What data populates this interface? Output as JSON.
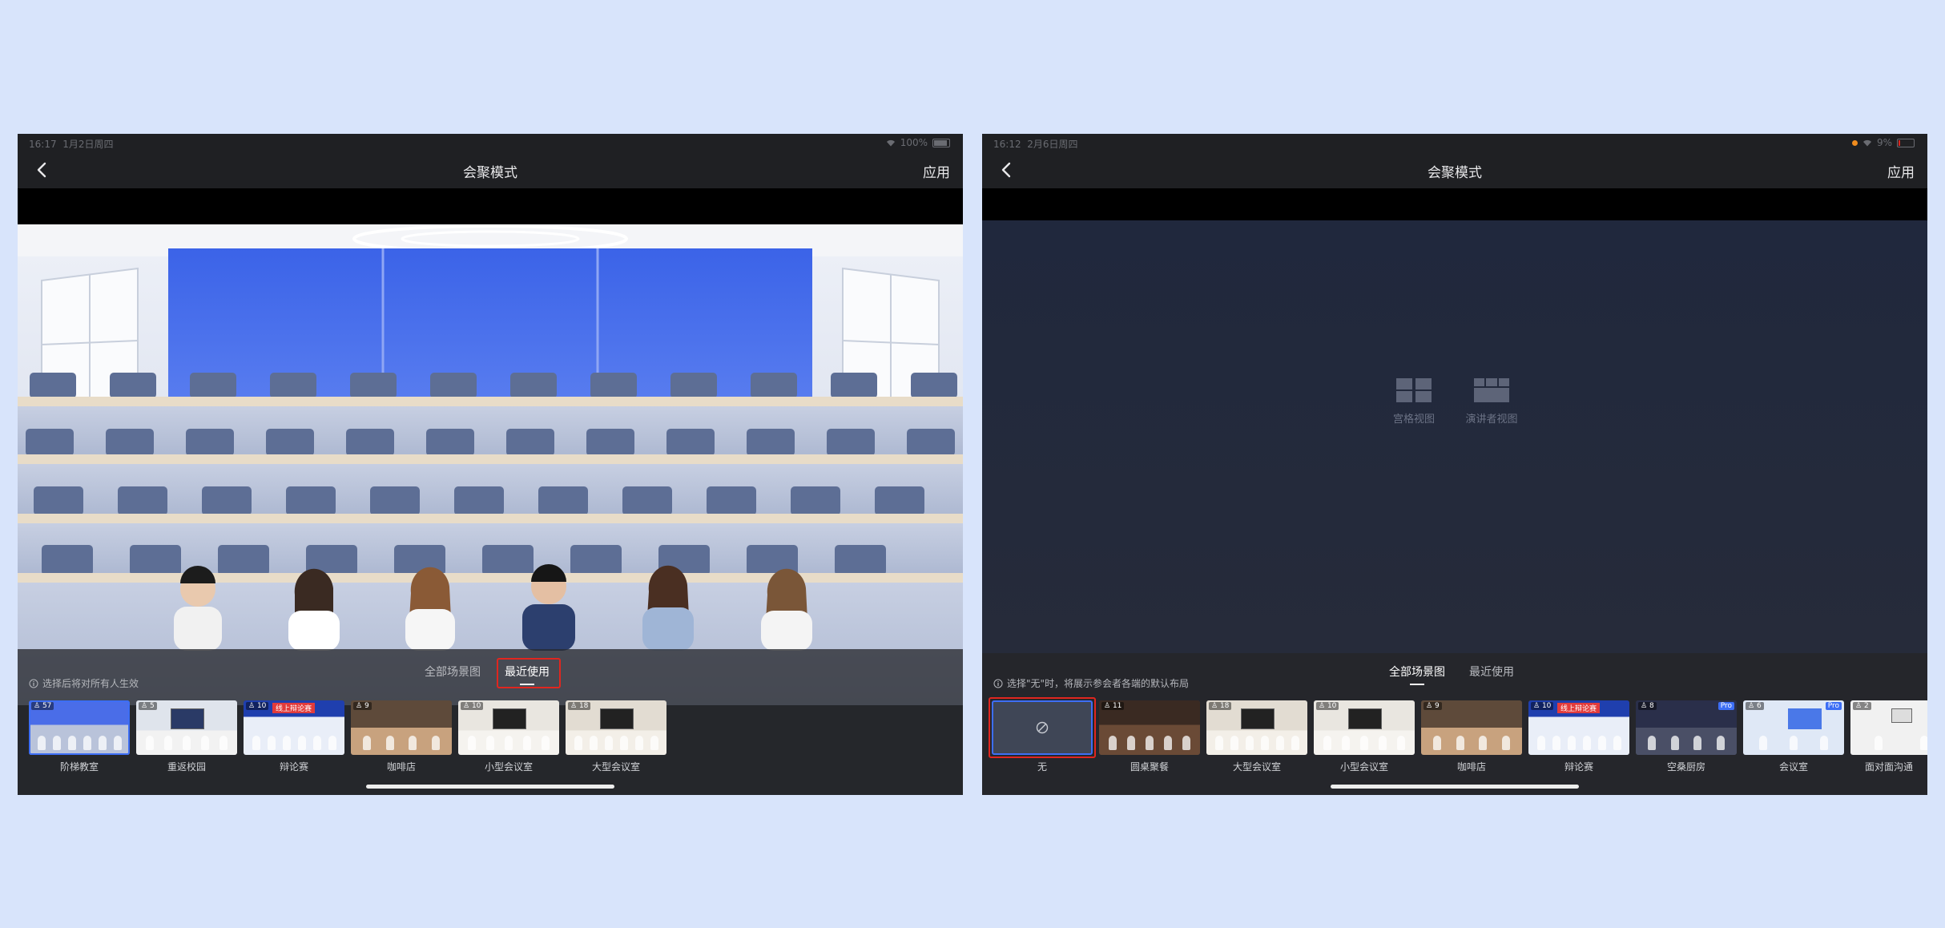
{
  "left": {
    "status": {
      "time": "16:17",
      "date": "1月2日周四",
      "battery": "100%"
    },
    "nav": {
      "title": "会聚模式",
      "apply": "应用"
    },
    "tabs": [
      {
        "label": "全部场景图",
        "active": false
      },
      {
        "label": "最近使用",
        "active": true
      }
    ],
    "hint": "选择后将对所有人生效",
    "scenes": [
      {
        "label": "阶梯教室",
        "count": "57",
        "selected": true
      },
      {
        "label": "重返校园",
        "count": "5"
      },
      {
        "label": "辩论赛",
        "count": "10",
        "banner": "线上辩论赛"
      },
      {
        "label": "咖啡店",
        "count": "9"
      },
      {
        "label": "小型会议室",
        "count": "10"
      },
      {
        "label": "大型会议室",
        "count": "18"
      }
    ]
  },
  "right": {
    "status": {
      "time": "16:12",
      "date": "2月6日周四",
      "battery": "9%"
    },
    "nav": {
      "title": "会聚模式",
      "apply": "应用"
    },
    "layouts": [
      {
        "label": "宫格视图",
        "icon": "grid-view-icon"
      },
      {
        "label": "演讲者视图",
        "icon": "speaker-view-icon"
      }
    ],
    "tabs": [
      {
        "label": "全部场景图",
        "active": true
      },
      {
        "label": "最近使用",
        "active": false
      }
    ],
    "hint": "选择\"无\"时，将展示参会者各端的默认布局",
    "scenes": [
      {
        "label": "无",
        "count": "",
        "none": true,
        "selected": true
      },
      {
        "label": "圆桌聚餐",
        "count": "11"
      },
      {
        "label": "大型会议室",
        "count": "18"
      },
      {
        "label": "小型会议室",
        "count": "10"
      },
      {
        "label": "咖啡店",
        "count": "9"
      },
      {
        "label": "辩论赛",
        "count": "10",
        "banner": "线上辩论赛"
      },
      {
        "label": "空桑厨房",
        "count": "8",
        "pro": "Pro"
      },
      {
        "label": "会议室",
        "count": "6",
        "pro": "Pro"
      },
      {
        "label": "面对面沟通",
        "count": "2"
      }
    ]
  },
  "colors": {
    "background": "#d8e4fb",
    "device": "#1f2023",
    "highlight_red": "#e0261f",
    "accent_blue": "#3d6ef5"
  }
}
